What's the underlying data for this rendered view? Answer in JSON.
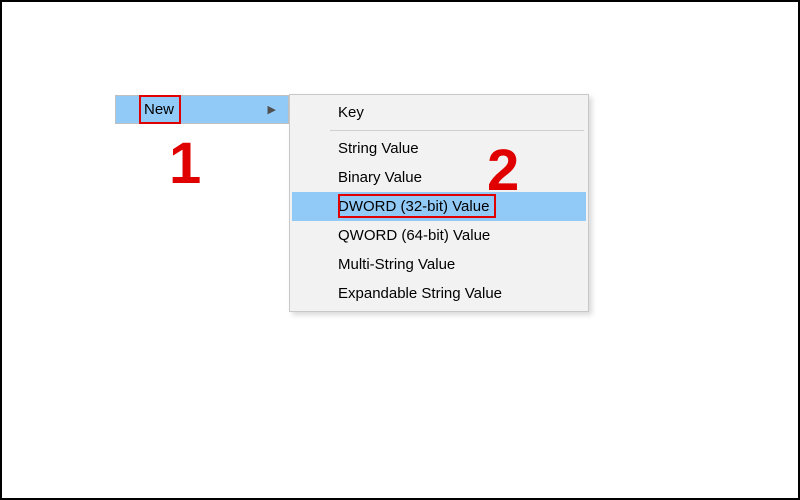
{
  "parent_menu": {
    "label": "New"
  },
  "submenu": {
    "items": [
      {
        "label": "Key"
      },
      {
        "label": "String Value"
      },
      {
        "label": "Binary Value"
      },
      {
        "label": "DWORD (32-bit) Value"
      },
      {
        "label": "QWORD (64-bit) Value"
      },
      {
        "label": "Multi-String Value"
      },
      {
        "label": "Expandable String Value"
      }
    ]
  },
  "annotations": {
    "one": "1",
    "two": "2"
  }
}
